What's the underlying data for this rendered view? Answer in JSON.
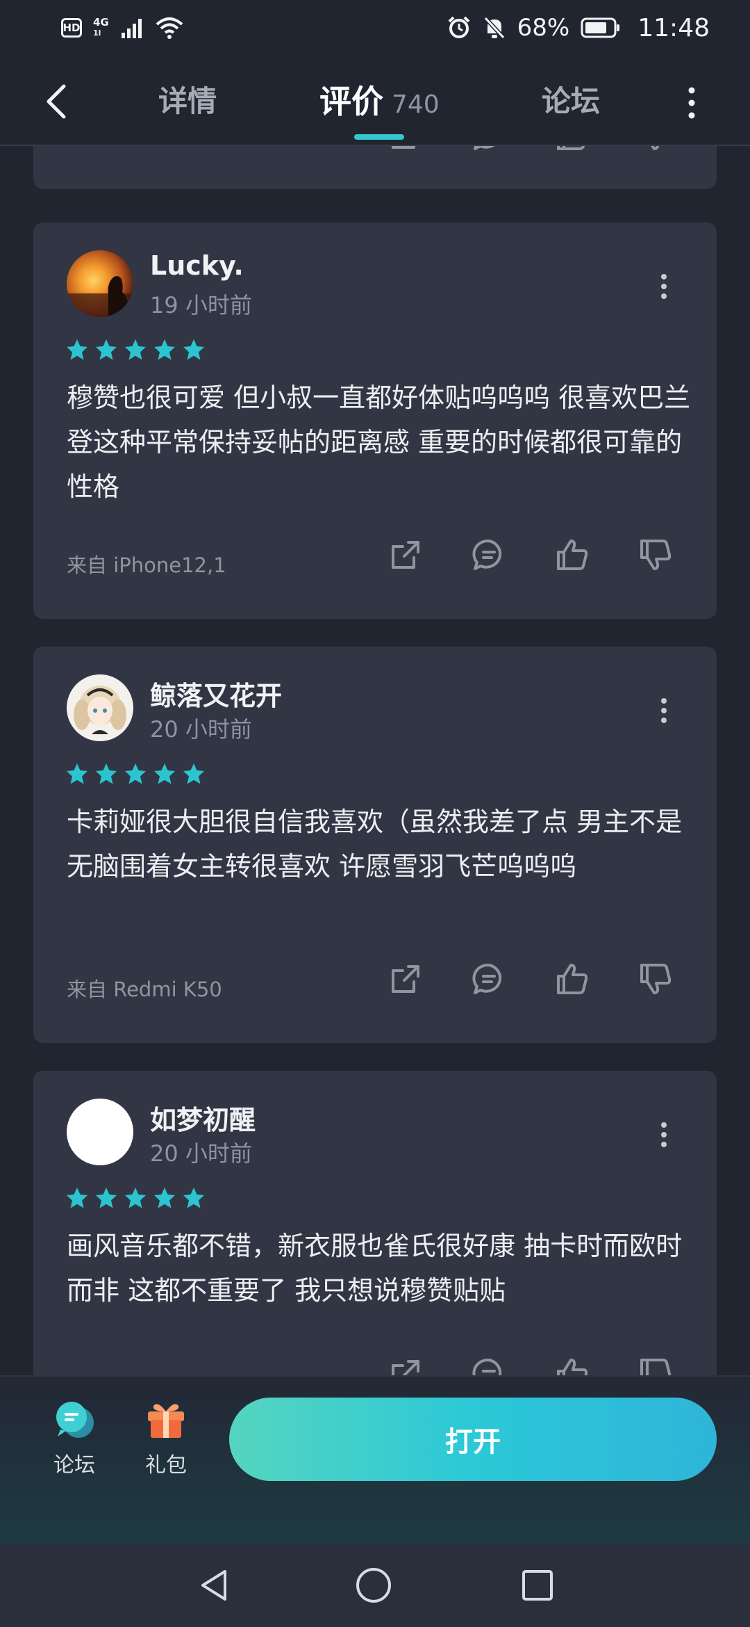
{
  "status_bar": {
    "hd": "HD",
    "network": "4G",
    "network_sub": "1l",
    "battery": "68%",
    "time": "11:48"
  },
  "nav": {
    "tabs": [
      {
        "label": "详情"
      },
      {
        "label": "评价",
        "count": "740"
      },
      {
        "label": "论坛"
      }
    ]
  },
  "reviews": [
    {
      "username": "Lucky.",
      "time": "19 小时前",
      "stars": 5,
      "text": "穆赞也很可爱 但小叔一直都好体贴呜呜呜 很喜欢巴兰登这种平常保持妥帖的距离感 重要的时候都很可靠的性格",
      "device": "来自 iPhone12,1"
    },
    {
      "username": "鲸落又花开",
      "time": "20 小时前",
      "stars": 5,
      "text": "卡莉娅很大胆很自信我喜欢（虽然我差了点 男主不是无脑围着女主转很喜欢 许愿雪羽飞芒呜呜呜",
      "device": "来自 Redmi K50"
    },
    {
      "username": "如梦初醒",
      "time": "20 小时前",
      "stars": 5,
      "text": "画风音乐都不错，新衣服也雀氏很好康 抽卡时而欧时而非 这都不重要了 我只想说穆赞贴贴",
      "device": ""
    }
  ],
  "bottom_bar": {
    "forum_label": "论坛",
    "gift_label": "礼包",
    "open_label": "打开"
  },
  "colors": {
    "background": "#212530",
    "card": "#323644",
    "accent": "#34c7cf",
    "star": "#2cc4cf"
  },
  "icons": [
    "back-icon",
    "more-vertical-icon",
    "star-icon",
    "share-icon",
    "comment-icon",
    "thumbs-up-icon",
    "thumbs-down-icon",
    "forum-icon",
    "gift-icon",
    "triangle-back-icon",
    "circle-home-icon",
    "square-recent-icon"
  ]
}
